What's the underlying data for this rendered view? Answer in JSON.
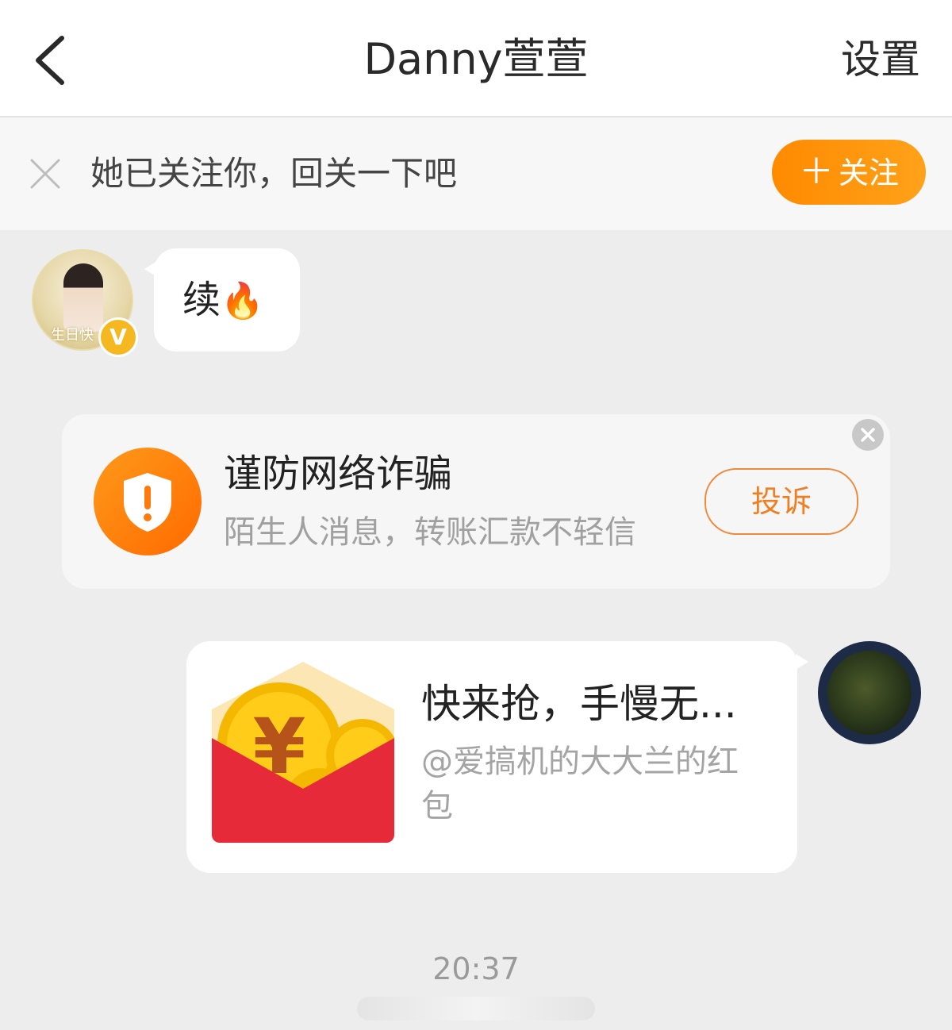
{
  "header": {
    "title": "Danny萱萱",
    "settings_label": "设置",
    "back_icon": "chevron-left-icon"
  },
  "follow_banner": {
    "text": "她已关注你，回关一下吧",
    "button_label": "关注",
    "button_plus": "＋",
    "accent_color": "#ff8a00"
  },
  "incoming": {
    "text": "续",
    "emoji": "🔥",
    "avatar_caption": "生日快",
    "verified_mark": "V"
  },
  "fraud_notice": {
    "title": "谨防网络诈骗",
    "subtitle": "陌生人消息，转账汇款不轻信",
    "button_label": "投诉"
  },
  "red_packet": {
    "title": "快来抢，手慢无...",
    "subtitle": "@爱搞机的大大兰的红包"
  },
  "timestamp": "20:37"
}
